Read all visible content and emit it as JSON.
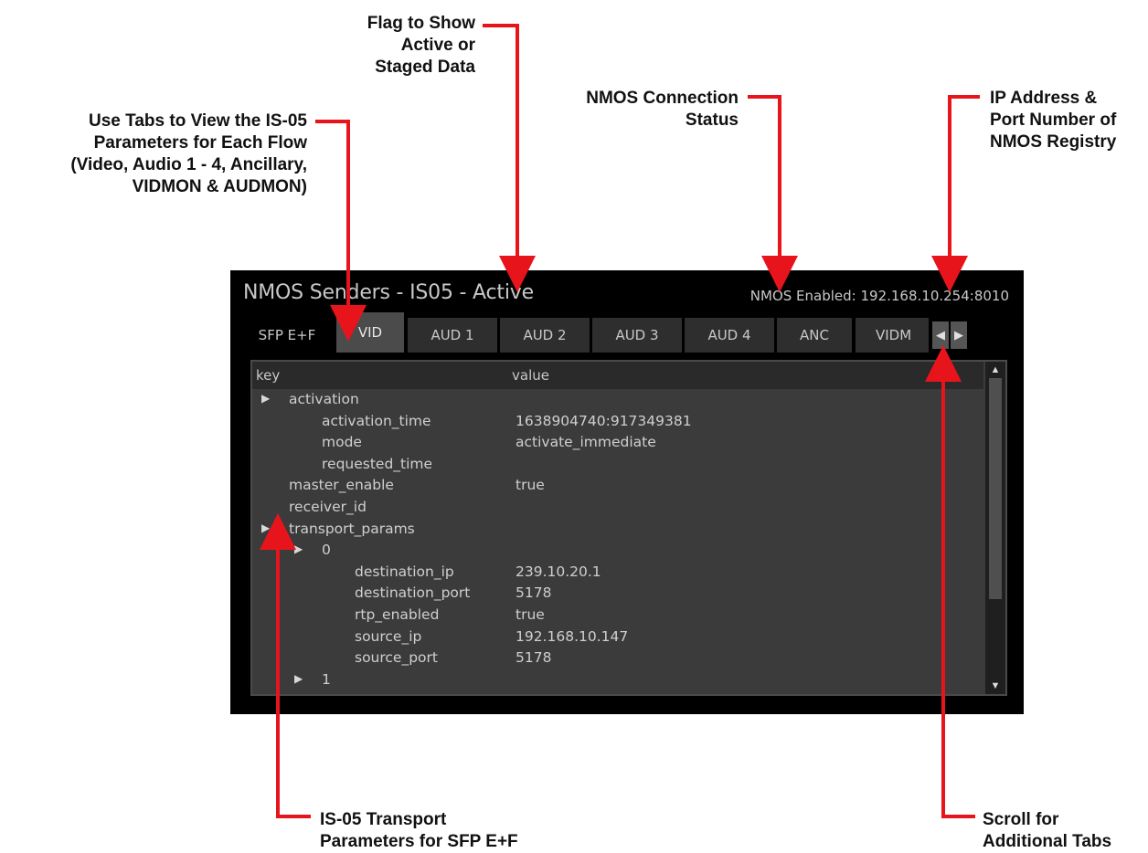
{
  "annotations": {
    "flag": [
      "Flag to Show",
      "Active or",
      "Staged Data"
    ],
    "nmos_status": [
      "NMOS Connection",
      "Status"
    ],
    "ip_address": [
      "IP Address &",
      "Port Number of",
      "NMOS Registry"
    ],
    "tabs_help": [
      "Use Tabs to View the IS-05",
      "Parameters for Each Flow",
      "(Video, Audio 1 - 4, Ancillary,",
      "VIDMON & AUDMON)"
    ],
    "transport": [
      "IS-05 Transport",
      "Parameters for SFP E+F"
    ],
    "scroll": [
      "Scroll for",
      "Additional Tabs"
    ],
    "arrow_color": "#e8141b"
  },
  "window": {
    "title": "NMOS Senders - IS05 - Active",
    "status": "NMOS Enabled: 192.168.10.254:8010"
  },
  "tabs": {
    "group": "SFP E+F",
    "items": [
      "VID",
      "AUD 1",
      "AUD 2",
      "AUD 3",
      "AUD 4",
      "ANC",
      "VIDM"
    ],
    "active": "VID",
    "scroll_left_icon": "triangle-left-icon",
    "scroll_right_icon": "triangle-right-icon"
  },
  "table": {
    "col_key": "key",
    "col_value": "value",
    "rows": [
      {
        "key": "activation",
        "value": "",
        "expandable": true
      },
      {
        "key": "activation_time",
        "value": "1638904740:917349381",
        "expandable": false
      },
      {
        "key": "mode",
        "value": "activate_immediate",
        "expandable": false
      },
      {
        "key": "requested_time",
        "value": "",
        "expandable": false
      },
      {
        "key": "master_enable",
        "value": "true",
        "expandable": false
      },
      {
        "key": "receiver_id",
        "value": "",
        "expandable": false
      },
      {
        "key": "transport_params",
        "value": "",
        "expandable": true
      },
      {
        "key": "0",
        "value": "",
        "expandable": true
      },
      {
        "key": "destination_ip",
        "value": "239.10.20.1",
        "expandable": false
      },
      {
        "key": "destination_port",
        "value": "5178",
        "expandable": false
      },
      {
        "key": "rtp_enabled",
        "value": "true",
        "expandable": false
      },
      {
        "key": "source_ip",
        "value": "192.168.10.147",
        "expandable": false
      },
      {
        "key": "source_port",
        "value": "5178",
        "expandable": false
      },
      {
        "key": "1",
        "value": "",
        "expandable": true
      }
    ]
  },
  "colors": {
    "panel_bg": "#000000",
    "table_bg": "#3b3b3b",
    "text": "#cfcfcf"
  }
}
